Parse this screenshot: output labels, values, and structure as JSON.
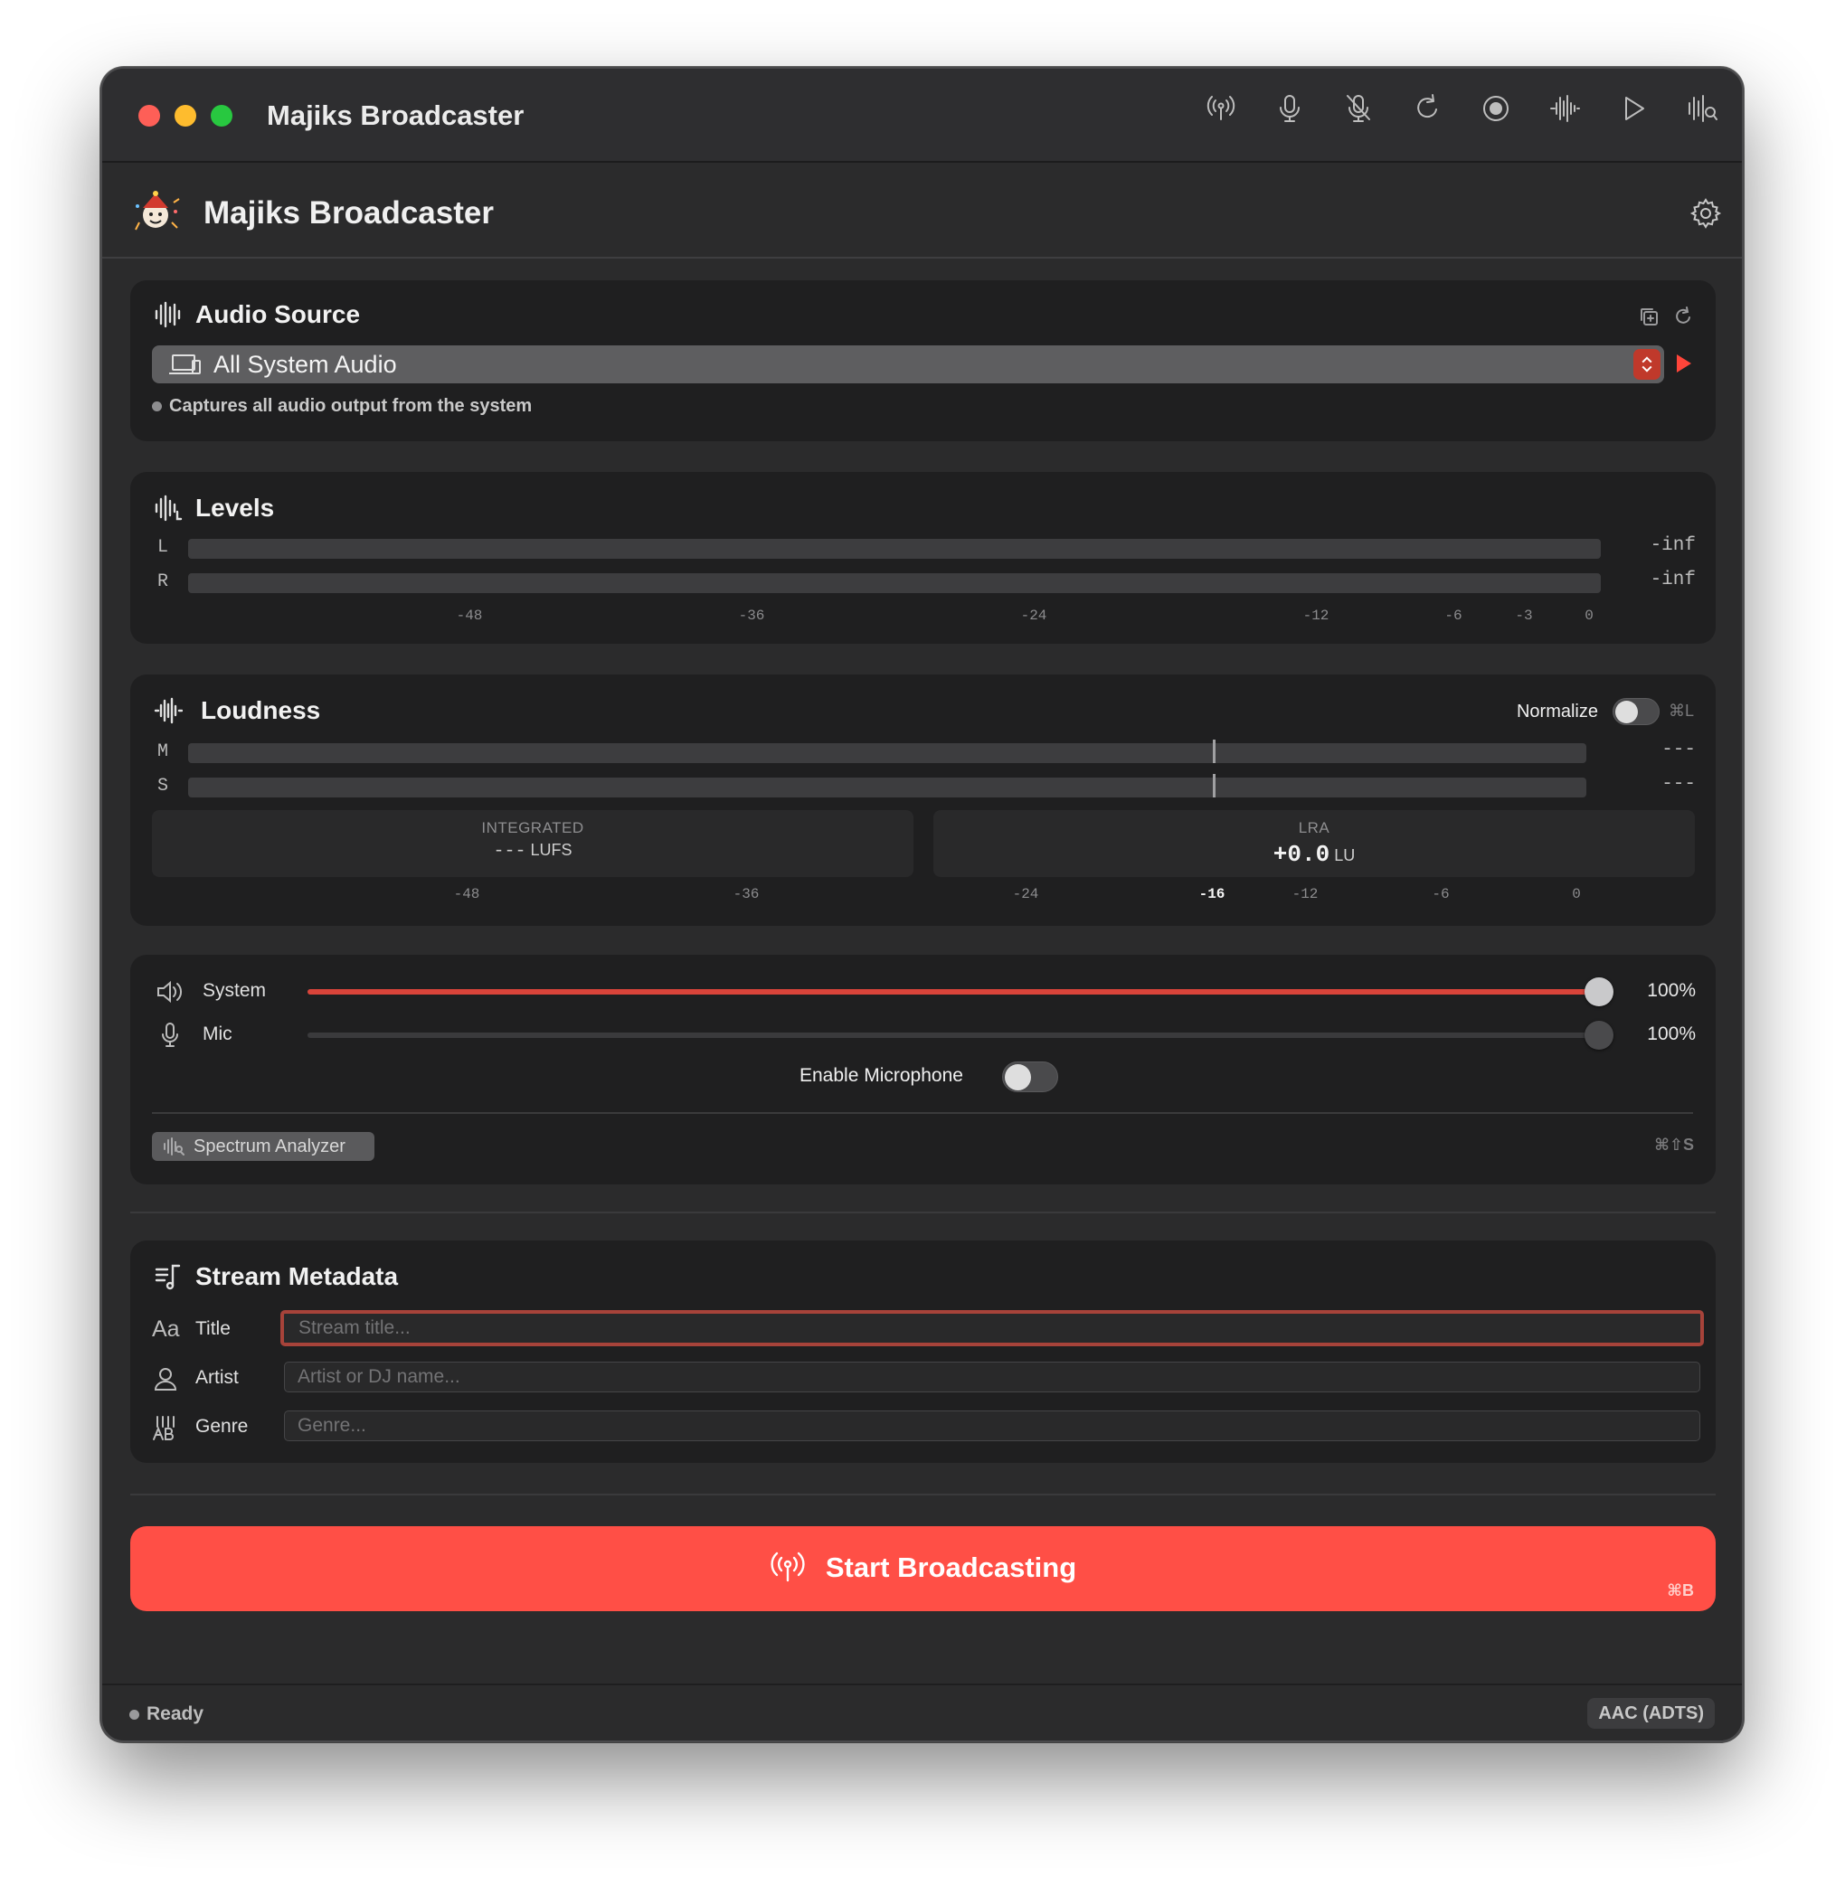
{
  "window": {
    "title": "Majiks Broadcaster"
  },
  "toolbar": {
    "icons": [
      "broadcast-icon",
      "mic-icon",
      "mic-off-icon",
      "refresh-icon",
      "record-icon",
      "waveform-icon",
      "play-icon",
      "spectrum-icon"
    ]
  },
  "header": {
    "app_name": "Majiks Broadcaster"
  },
  "audio_source": {
    "title": "Audio Source",
    "selected": "All System Audio",
    "description": "Captures all audio output from the system"
  },
  "levels": {
    "title": "Levels",
    "channels": [
      {
        "label": "L",
        "value": "-inf"
      },
      {
        "label": "R",
        "value": "-inf"
      }
    ],
    "scale": [
      "-48",
      "-36",
      "-24",
      "-12",
      "-6",
      "-3",
      "0"
    ]
  },
  "loudness": {
    "title": "Loudness",
    "normalize_label": "Normalize",
    "normalize_shortcut": "⌘L",
    "normalize_on": false,
    "channels": [
      {
        "label": "M",
        "value": "---"
      },
      {
        "label": "S",
        "value": "---"
      }
    ],
    "integrated": {
      "label": "INTEGRATED",
      "value": "---",
      "unit": "LUFS"
    },
    "lra": {
      "label": "LRA",
      "value": "+0.0",
      "unit": "LU"
    },
    "scale": [
      "-48",
      "-36",
      "-24",
      "-16",
      "-12",
      "-6",
      "0"
    ],
    "target": "-16"
  },
  "mixer": {
    "system": {
      "label": "System",
      "value": "100%",
      "level": 1.0
    },
    "mic": {
      "label": "Mic",
      "value": "100%",
      "level": 1.0
    },
    "enable_mic_label": "Enable Microphone",
    "enable_mic_on": false,
    "spectrum_label": "Spectrum Analyzer",
    "spectrum_shortcut": "⌘⇧S"
  },
  "metadata": {
    "title": "Stream Metadata",
    "fields": [
      {
        "icon": "Aa",
        "label": "Title",
        "placeholder": "Stream title..."
      },
      {
        "label": "Artist",
        "placeholder": "Artist or DJ name..."
      },
      {
        "label": "Genre",
        "placeholder": "Genre..."
      }
    ]
  },
  "start": {
    "label": "Start Broadcasting",
    "shortcut": "⌘B"
  },
  "status": {
    "text": "Ready",
    "codec": "AAC (ADTS)"
  },
  "colors": {
    "accent": "#ff4f46",
    "background": "#2b2b2c",
    "card": "#1f1f20"
  }
}
